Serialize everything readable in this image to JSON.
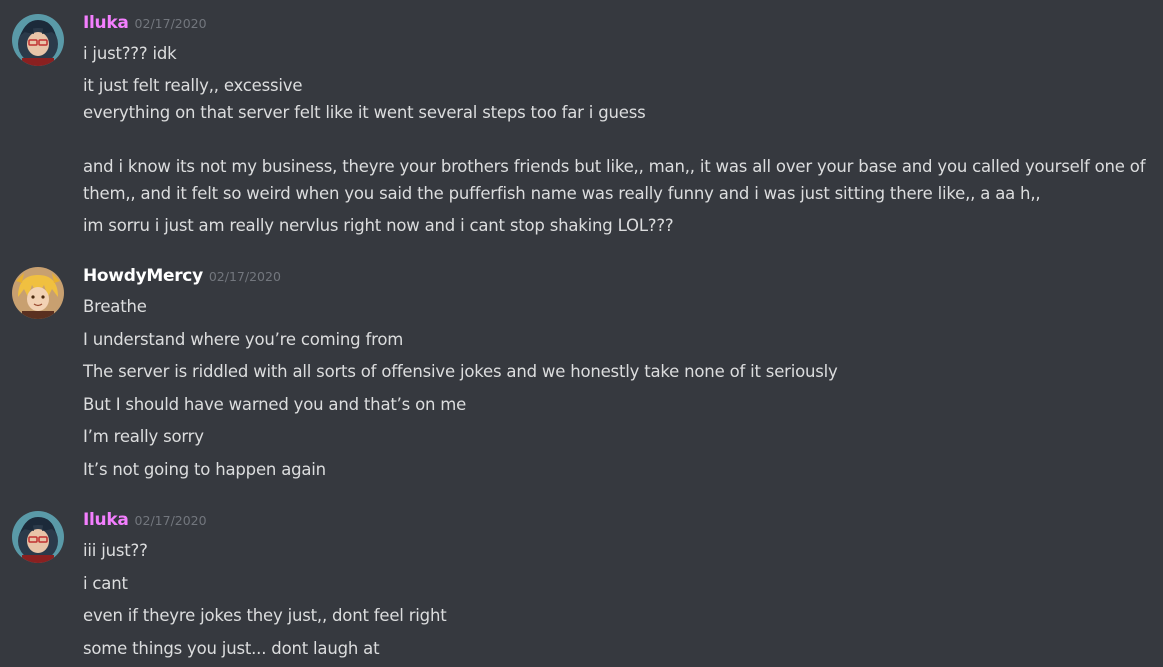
{
  "colors": {
    "background": "#36393f",
    "text": "#dcddde",
    "timestamp": "#72767d",
    "user_iluka": "#f47fff",
    "user_howdymercy": "#ffffff"
  },
  "messages": [
    {
      "username": "Iluka",
      "timestamp": "02/17/2020",
      "avatar_icon": "avatar-icon",
      "lines": [
        "i  just??? idk",
        "it just felt really,, excessive",
        "everything on that server felt like it went several steps too far i guess",
        "and i know its not my business, theyre your brothers friends but like,, man,, it was all over your base and you called yourself one of them,, and it felt so weird when you said the pufferfish name was really funny and i was just sitting there like,, a aa  h,,",
        "im sorru i just am really nervlus right now and i cant stop shaking LOL???"
      ]
    },
    {
      "username": "HowdyMercy",
      "timestamp": "02/17/2020",
      "avatar_icon": "avatar-icon",
      "lines": [
        "Breathe",
        "I understand where you’re coming from",
        "The server is riddled with all sorts of offensive jokes and we honestly take none of it seriously",
        "But I should have warned you and that’s on me",
        "I’m really sorry",
        "It’s not going to happen again"
      ]
    },
    {
      "username": "Iluka",
      "timestamp": "02/17/2020",
      "avatar_icon": "avatar-icon",
      "lines": [
        "iii just??",
        "i cant",
        "even if theyre jokes they just,, dont feel right",
        "some things you just... dont laugh at"
      ]
    }
  ]
}
